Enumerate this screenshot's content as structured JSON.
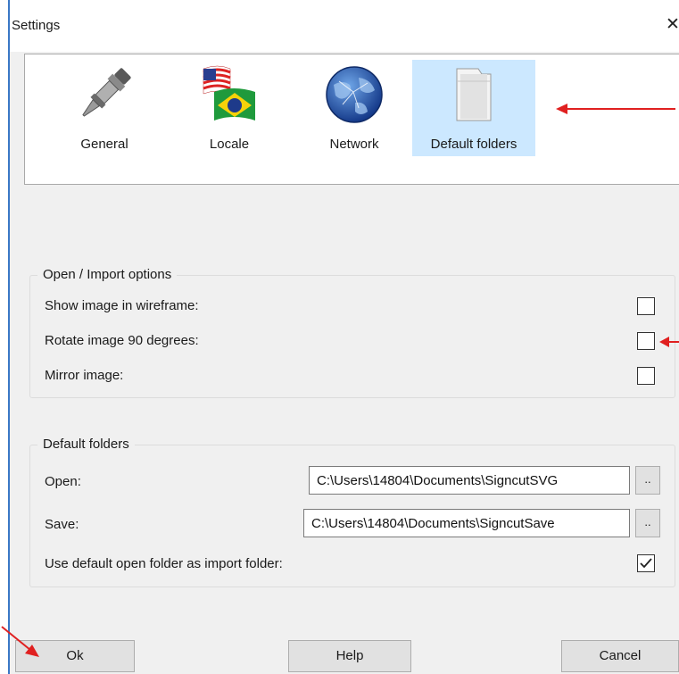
{
  "window": {
    "title": "Settings",
    "close_glyph": "✕"
  },
  "tabs": [
    {
      "label": "General",
      "icon": "pen-icon"
    },
    {
      "label": "Locale",
      "icon": "flags-icon"
    },
    {
      "label": "Network",
      "icon": "globe-icon"
    },
    {
      "label": "Default folders",
      "icon": "folder-icon",
      "selected": true
    }
  ],
  "open_import": {
    "title": "Open / Import options",
    "options": [
      {
        "label": "Show image in wireframe:",
        "checked": false
      },
      {
        "label": "Rotate image 90 degrees:",
        "checked": false
      },
      {
        "label": "Mirror image:",
        "checked": false
      }
    ]
  },
  "default_folders": {
    "title": "Default folders",
    "open_label": "Open:",
    "open_value": "C:\\Users\\14804\\Documents\\SigncutSVG",
    "save_label": "Save:",
    "save_value": "C:\\Users\\14804\\Documents\\SigncutSave",
    "browse_label": "..",
    "use_default_label": "Use default open folder as import folder:",
    "use_default_checked": true
  },
  "buttons": {
    "ok": "Ok",
    "help": "Help",
    "cancel": "Cancel"
  },
  "colors": {
    "annotation_arrow": "#e02020",
    "selected_tab": "#cce8ff",
    "window_border": "#3a78c6"
  }
}
